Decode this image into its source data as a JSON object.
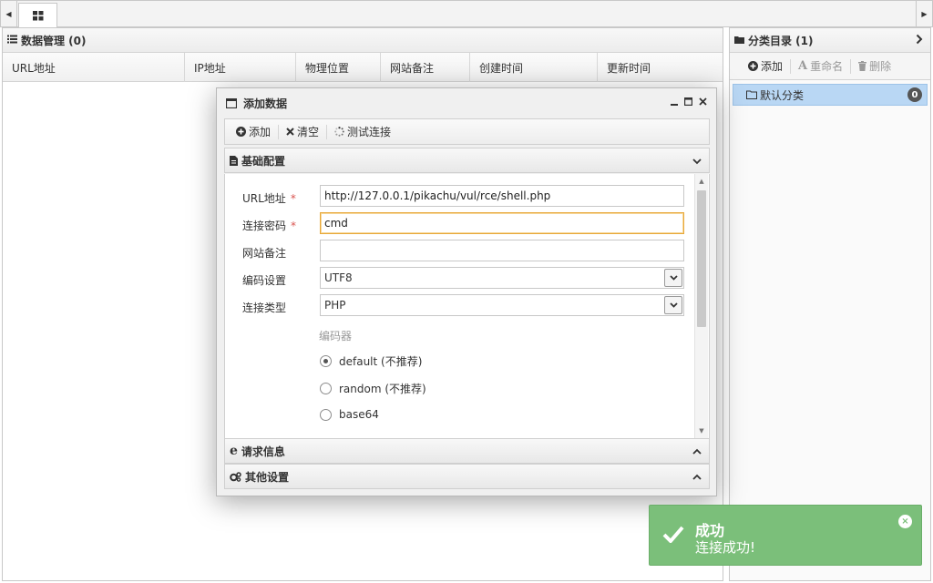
{
  "left_panel": {
    "title": "数据管理 (0)",
    "columns": [
      "URL地址",
      "IP地址",
      "物理位置",
      "网站备注",
      "创建时间",
      "更新时间"
    ]
  },
  "right_panel": {
    "title": "分类目录 (1)",
    "toolbar": {
      "add": "添加",
      "rename": "重命名",
      "delete": "删除"
    },
    "categories": [
      {
        "label": "默认分类",
        "count": "0"
      }
    ]
  },
  "dialog": {
    "title": "添加数据",
    "toolbar": {
      "add": "添加",
      "clear": "清空",
      "test": "测试连接"
    },
    "sections": {
      "basic": "基础配置",
      "request": "请求信息",
      "other": "其他设置"
    },
    "form": {
      "url_label": "URL地址",
      "url_value": "http://127.0.0.1/pikachu/vul/rce/shell.php",
      "password_label": "连接密码",
      "password_value": "cmd",
      "note_label": "网站备注",
      "note_value": "",
      "encoding_label": "编码设置",
      "encoding_value": "UTF8",
      "type_label": "连接类型",
      "type_value": "PHP",
      "encoder_label": "编码器",
      "required_mark": "*",
      "encoders": [
        {
          "label": "default (不推荐)",
          "selected": true
        },
        {
          "label": "random (不推荐)",
          "selected": false
        },
        {
          "label": "base64",
          "selected": false
        }
      ]
    }
  },
  "toast": {
    "title": "成功",
    "message": "连接成功!",
    "color": "#7bbf7a"
  }
}
